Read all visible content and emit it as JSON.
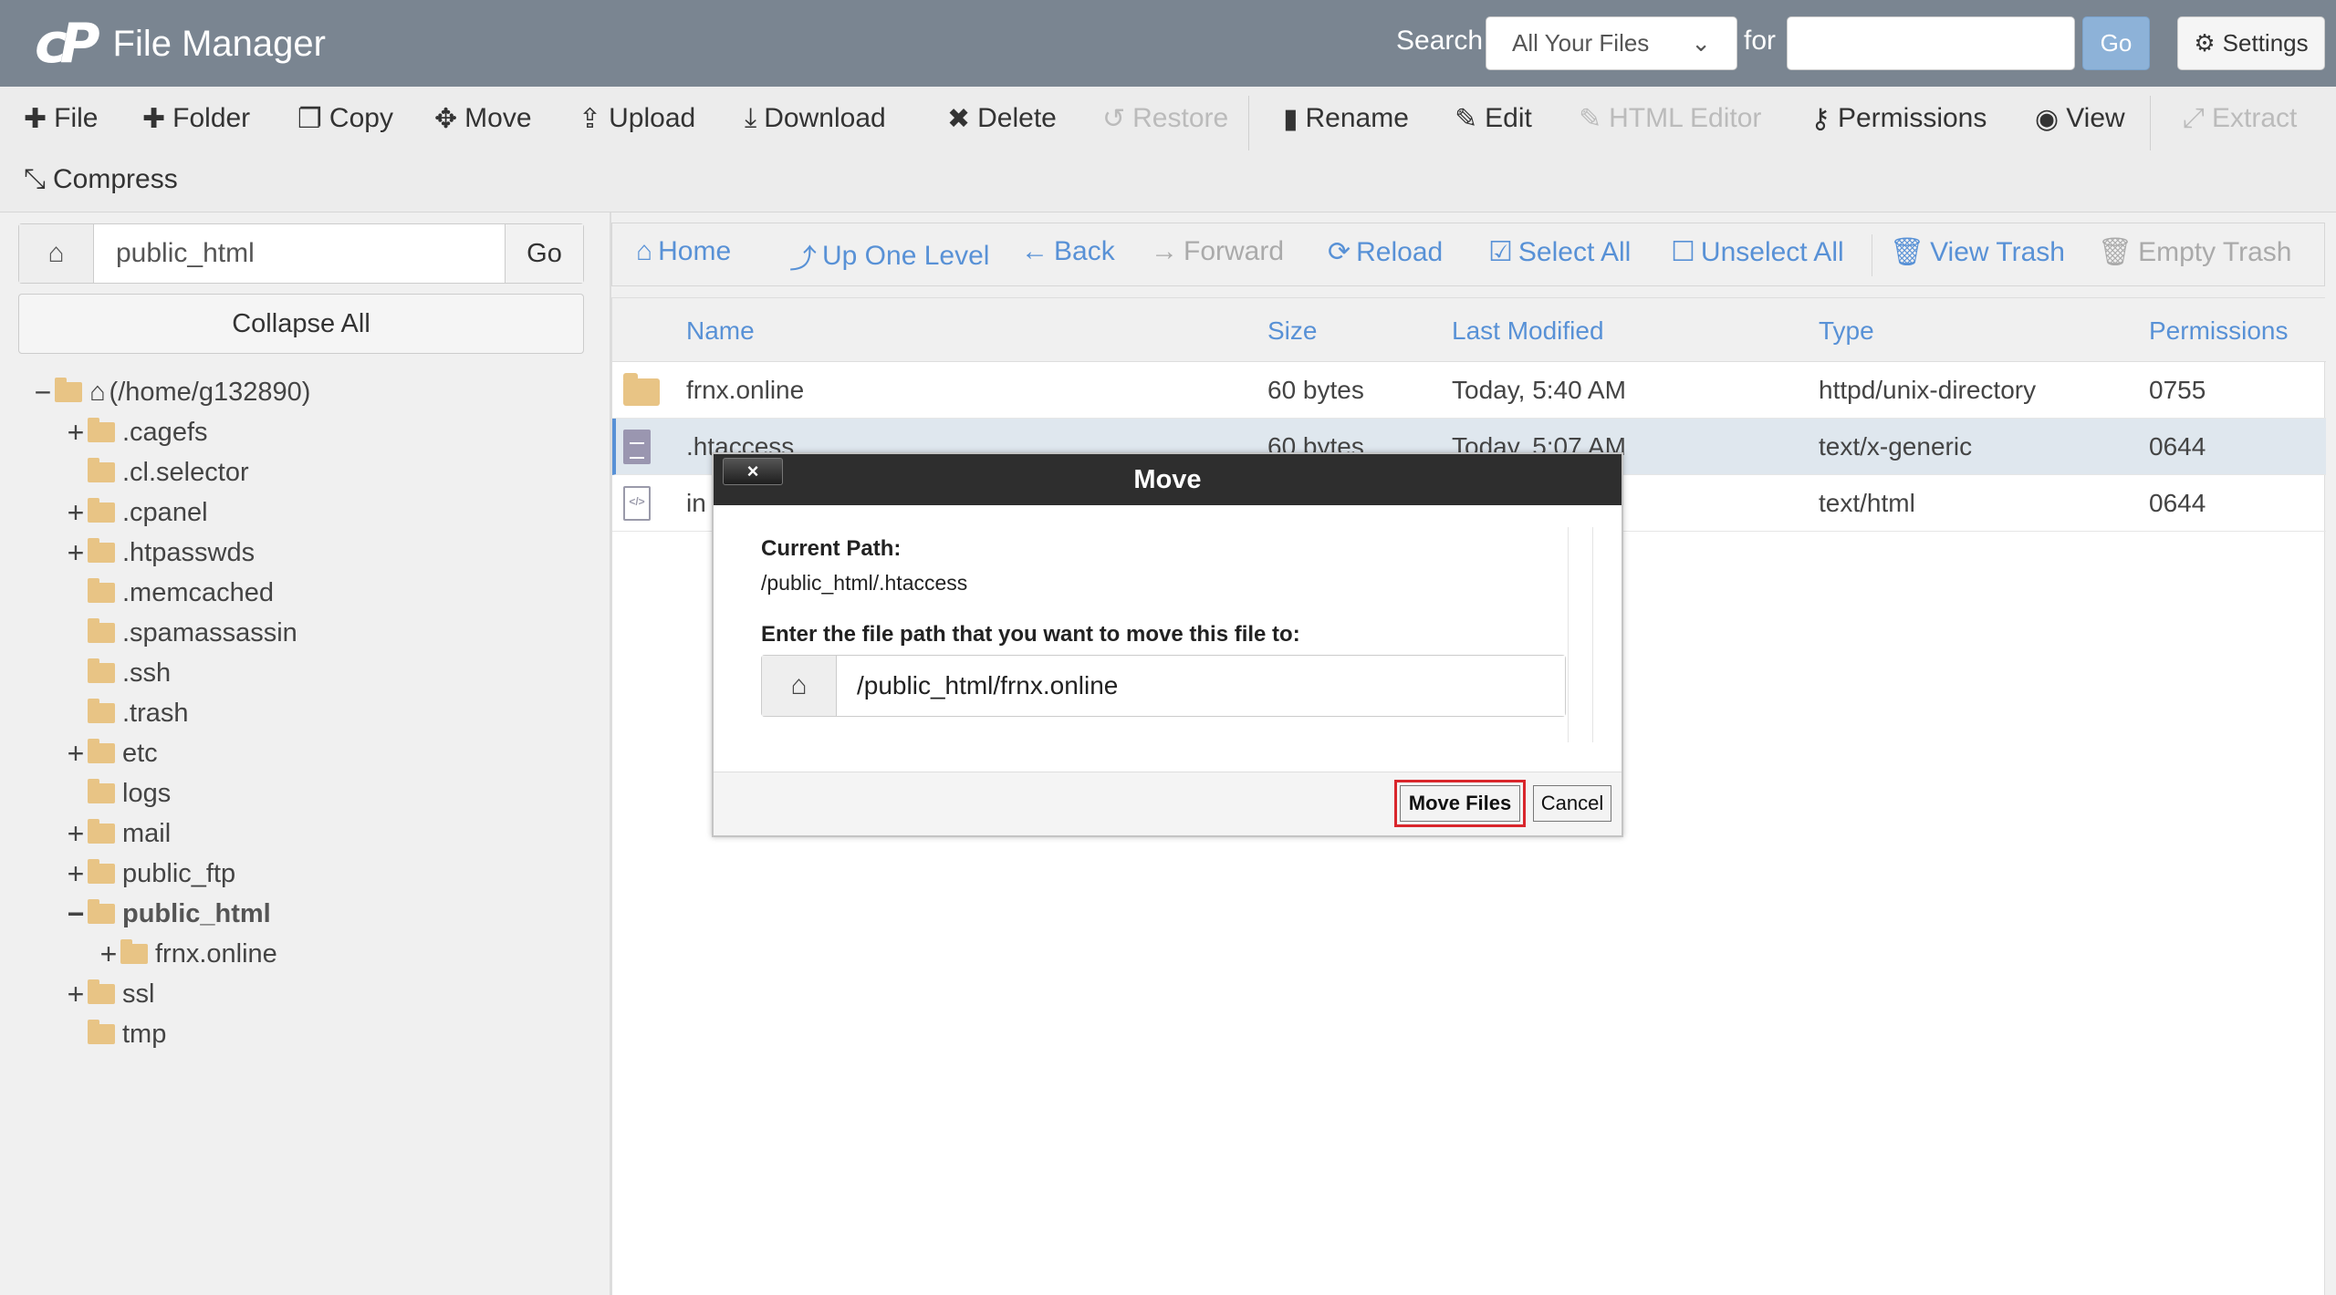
{
  "header": {
    "logo_mark": "cP",
    "title": "File Manager",
    "search_label": "Search",
    "search_scope": "All Your Files",
    "for_label": "for",
    "search_value": "",
    "go_label": "Go",
    "settings_label": "Settings"
  },
  "toolbar": {
    "items": [
      {
        "label": "File",
        "icon": "plus-icon",
        "enabled": true
      },
      {
        "label": "Folder",
        "icon": "plus-icon",
        "enabled": true
      },
      {
        "label": "Copy",
        "icon": "copy-icon",
        "enabled": true
      },
      {
        "label": "Move",
        "icon": "move-icon",
        "enabled": true
      },
      {
        "label": "Upload",
        "icon": "upload-icon",
        "enabled": true
      },
      {
        "label": "Download",
        "icon": "download-icon",
        "enabled": true
      },
      {
        "label": "Delete",
        "icon": "close-icon",
        "enabled": true
      },
      {
        "label": "Restore",
        "icon": "undo-icon",
        "enabled": false
      },
      {
        "label": "Rename",
        "icon": "file-icon",
        "enabled": true
      },
      {
        "label": "Edit",
        "icon": "pencil-icon",
        "enabled": true
      },
      {
        "label": "HTML Editor",
        "icon": "edit-icon",
        "enabled": false
      },
      {
        "label": "Permissions",
        "icon": "key-icon",
        "enabled": true
      },
      {
        "label": "View",
        "icon": "eye-icon",
        "enabled": true
      },
      {
        "label": "Extract",
        "icon": "expand-icon",
        "enabled": false
      },
      {
        "label": "Compress",
        "icon": "compress-icon",
        "enabled": true
      }
    ]
  },
  "left": {
    "path_value": "public_html",
    "go_label": "Go",
    "collapse_label": "Collapse All",
    "tree": [
      {
        "label": "(/home/g132890)",
        "toggle": "−"
      },
      {
        "label": ".cagefs",
        "toggle": "+"
      },
      {
        "label": ".cl.selector",
        "toggle": ""
      },
      {
        "label": ".cpanel",
        "toggle": "+"
      },
      {
        "label": ".htpasswds",
        "toggle": "+"
      },
      {
        "label": ".memcached",
        "toggle": ""
      },
      {
        "label": ".spamassassin",
        "toggle": ""
      },
      {
        "label": ".ssh",
        "toggle": ""
      },
      {
        "label": ".trash",
        "toggle": ""
      },
      {
        "label": "etc",
        "toggle": "+"
      },
      {
        "label": "logs",
        "toggle": ""
      },
      {
        "label": "mail",
        "toggle": "+"
      },
      {
        "label": "public_ftp",
        "toggle": "+"
      },
      {
        "label": "public_html",
        "toggle": "−"
      },
      {
        "label": "frnx.online",
        "toggle": "+"
      },
      {
        "label": "ssl",
        "toggle": "+"
      },
      {
        "label": "tmp",
        "toggle": ""
      }
    ]
  },
  "nav": {
    "items": [
      {
        "label": "Home",
        "icon": "home-icon",
        "enabled": true
      },
      {
        "label": "Up One Level",
        "icon": "level-up-icon",
        "enabled": true
      },
      {
        "label": "Back",
        "icon": "arrow-left-icon",
        "enabled": true
      },
      {
        "label": "Forward",
        "icon": "arrow-right-icon",
        "enabled": false
      },
      {
        "label": "Reload",
        "icon": "refresh-icon",
        "enabled": true
      },
      {
        "label": "Select All",
        "icon": "checkbox-checked-icon",
        "enabled": true
      },
      {
        "label": "Unselect All",
        "icon": "checkbox-empty-icon",
        "enabled": true
      },
      {
        "label": "View Trash",
        "icon": "trash-icon",
        "enabled": true
      },
      {
        "label": "Empty Trash",
        "icon": "trash-icon",
        "enabled": false
      }
    ]
  },
  "table": {
    "columns": [
      "Name",
      "Size",
      "Last Modified",
      "Type",
      "Permissions"
    ],
    "rows": [
      {
        "name": "frnx.online",
        "size": "60 bytes",
        "modified": "Today, 5:40 AM",
        "type": "httpd/unix-directory",
        "perms": "0755",
        "icon": "folder-icon",
        "selected": false
      },
      {
        "name": ".htaccess",
        "size": "60 bytes",
        "modified": "Today, 5:07 AM",
        "type": "text/x-generic",
        "perms": "0644",
        "icon": "text-file-icon",
        "selected": true
      },
      {
        "name": "in",
        "size": "",
        "modified": "",
        "type": "text/html",
        "perms": "0644",
        "icon": "code-file-icon",
        "selected": false
      }
    ]
  },
  "modal": {
    "title": "Move",
    "close_label": "×",
    "current_path_label": "Current Path:",
    "current_path_value": "/public_html/.htaccess",
    "dest_label": "Enter the file path that you want to move this file to:",
    "dest_value": "/public_html/frnx.online",
    "move_label": "Move Files",
    "cancel_label": "Cancel"
  }
}
